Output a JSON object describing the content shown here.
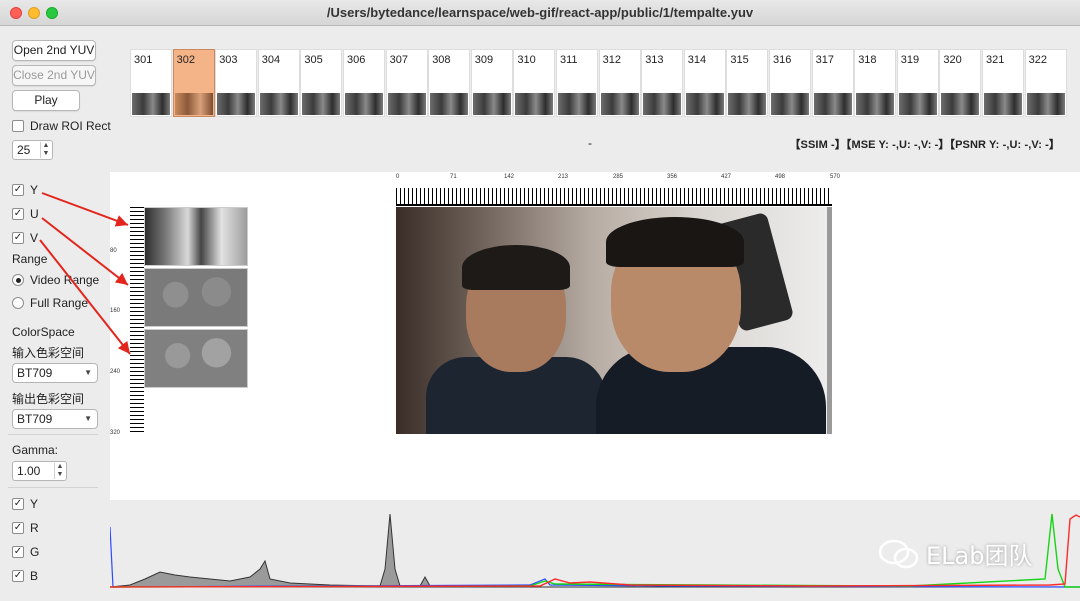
{
  "window": {
    "title": "/Users/bytedance/learnspace/web-gif/react-app/public/1/tempalte.yuv"
  },
  "controls": {
    "open_2nd_yuv": "Open 2nd YUV",
    "close_2nd_yuv": "Close 2nd YUV",
    "play": "Play",
    "draw_roi": "Draw ROI Rect",
    "roi_value": "25",
    "planes": {
      "y": "Y",
      "u": "U",
      "v": "V"
    },
    "range_label": "Range",
    "video_range": "Video Range",
    "full_range": "Full Range",
    "colorspace_label": "ColorSpace",
    "input_cs_label": "输入色彩空间",
    "input_cs_value": "BT709",
    "output_cs_label": "输出色彩空间",
    "output_cs_value": "BT709",
    "gamma_label": "Gamma:",
    "gamma_value": "1.00",
    "hist_channels": {
      "y": "Y",
      "r": "R",
      "g": "G",
      "b": "B"
    }
  },
  "frames": [
    "301",
    "302",
    "303",
    "304",
    "305",
    "306",
    "307",
    "308",
    "309",
    "310",
    "311",
    "312",
    "313",
    "314",
    "315",
    "316",
    "317",
    "318",
    "319",
    "320",
    "321",
    "322"
  ],
  "selected_frame": "302",
  "dash": "-",
  "metrics": "【SSIM -】【MSE Y: -,U: -,V: -】【PSNR Y: -,U: -,V: -】",
  "ruler": {
    "h_ticks": [
      "0",
      "71",
      "142",
      "213",
      "285",
      "356",
      "427",
      "498",
      "570"
    ],
    "v_ticks": [
      "80",
      "160",
      "240",
      "320"
    ]
  },
  "watermark": {
    "brand": "ELab团队"
  },
  "colors": {
    "selected_frame": "#f4b488",
    "annotation_arrow": "#e3261d",
    "hist_y": "#555555",
    "hist_r": "#ff2a2a",
    "hist_g": "#18d418",
    "hist_b": "#2a4bff"
  }
}
